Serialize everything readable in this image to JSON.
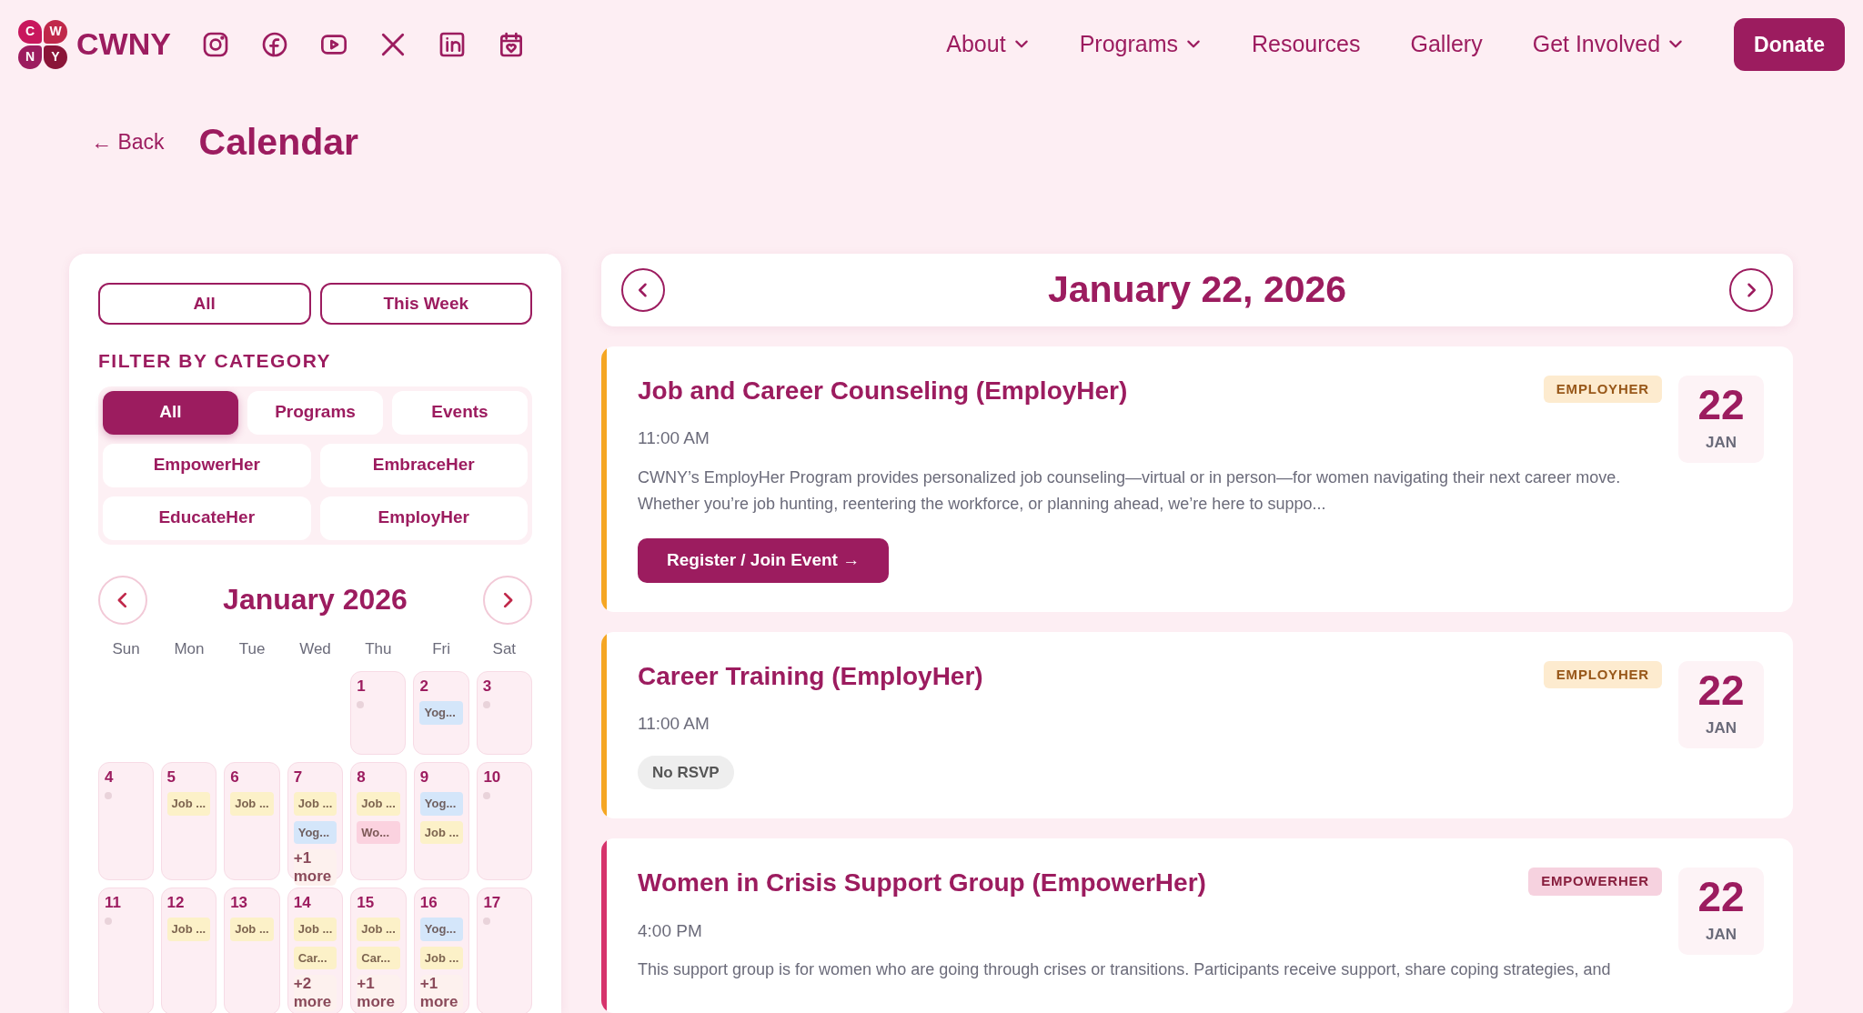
{
  "header": {
    "logo_letters": [
      "C",
      "W",
      "N",
      "Y"
    ],
    "brand": "CWNY",
    "nav": [
      {
        "label": "About",
        "dropdown": true
      },
      {
        "label": "Programs",
        "dropdown": true
      },
      {
        "label": "Resources",
        "dropdown": false
      },
      {
        "label": "Gallery",
        "dropdown": false
      },
      {
        "label": "Get Involved",
        "dropdown": true
      }
    ],
    "donate": "Donate"
  },
  "page": {
    "back": "← Back",
    "title": "Calendar"
  },
  "sidebar": {
    "range_tabs": [
      {
        "label": "All"
      },
      {
        "label": "This Week"
      }
    ],
    "filter_heading": "FILTER BY CATEGORY",
    "categories": [
      {
        "label": "All",
        "selected": true
      },
      {
        "label": "Programs",
        "selected": false
      },
      {
        "label": "Events",
        "selected": false
      },
      {
        "label": "EmpowerHer",
        "selected": false
      },
      {
        "label": "EmbraceHer",
        "selected": false
      },
      {
        "label": "EducateHer",
        "selected": false
      },
      {
        "label": "EmployHer",
        "selected": false
      }
    ],
    "month": "January 2026",
    "weekdays": [
      "Sun",
      "Mon",
      "Tue",
      "Wed",
      "Thu",
      "Fri",
      "Sat"
    ],
    "weeks": [
      {
        "days": [
          {
            "day": "1"
          },
          {
            "day": "2",
            "events": [
              {
                "label": "Yog...",
                "color": "#d4e6fa"
              }
            ]
          },
          {
            "day": "3"
          }
        ]
      },
      {
        "days": [
          {
            "day": "4"
          },
          {
            "day": "5",
            "events": [
              {
                "label": "Job ...",
                "color": "#fcf1c8"
              }
            ]
          },
          {
            "day": "6",
            "events": [
              {
                "label": "Job ...",
                "color": "#fcf1c8"
              }
            ]
          },
          {
            "day": "7",
            "events": [
              {
                "label": "Job ...",
                "color": "#fcf1c8"
              },
              {
                "label": "Yog...",
                "color": "#d4e6fa"
              }
            ],
            "more": "+1 more"
          },
          {
            "day": "8",
            "events": [
              {
                "label": "Job ...",
                "color": "#fcf1c8"
              },
              {
                "label": "Wo...",
                "color": "#fbd2df"
              }
            ]
          },
          {
            "day": "9",
            "events": [
              {
                "label": "Yog...",
                "color": "#d4e6fa"
              },
              {
                "label": "Job ...",
                "color": "#fcf1c8"
              }
            ]
          },
          {
            "day": "10"
          }
        ]
      },
      {
        "days": [
          {
            "day": "11"
          },
          {
            "day": "12",
            "events": [
              {
                "label": "Job ...",
                "color": "#fcf1c8"
              }
            ]
          },
          {
            "day": "13",
            "events": [
              {
                "label": "Job ...",
                "color": "#fcf1c8"
              }
            ]
          },
          {
            "day": "14",
            "events": [
              {
                "label": "Job ...",
                "color": "#fcf1c8"
              },
              {
                "label": "Car...",
                "color": "#fcf1c8"
              }
            ],
            "more": "+2 more"
          },
          {
            "day": "15",
            "events": [
              {
                "label": "Job ...",
                "color": "#fcf1c8"
              },
              {
                "label": "Car...",
                "color": "#fcf1c8"
              }
            ],
            "more": "+1 more"
          },
          {
            "day": "16",
            "events": [
              {
                "label": "Yog...",
                "color": "#d4e6fa"
              },
              {
                "label": "Job ...",
                "color": "#fcf1c8"
              }
            ],
            "more": "+1 more"
          },
          {
            "day": "17"
          }
        ]
      }
    ]
  },
  "day_view": {
    "date": "January 22, 2026",
    "events": [
      {
        "title": "Job and Career Counseling (EmployHer)",
        "color": "#f5a623",
        "badge": "EMPLOYHER",
        "time": "11:00 AM",
        "description": "CWNY’s EmployHer Program provides personalized job counseling—virtual or in person—for women navigating their next career move. Whether you’re job hunting, reentering the workforce, or planning ahead, we’re here to suppo...",
        "action": {
          "kind": "button",
          "label": "Register / Join Event →"
        },
        "day": "22",
        "month": "JAN"
      },
      {
        "title": "Career Training (EmployHer)",
        "color": "#f5a623",
        "badge": "EMPLOYHER",
        "time": "11:00 AM",
        "action": {
          "kind": "pill",
          "label": "No RSVP"
        },
        "day": "22",
        "month": "JAN"
      },
      {
        "title": "Women in Crisis Support Group (EmpowerHer)",
        "color": "#d6336c",
        "badge": "EMPOWERHER",
        "time": "4:00 PM",
        "description": "This support group is for women who are going through crises or transitions. Participants receive support, share coping strategies, and",
        "day": "22",
        "month": "JAN"
      }
    ]
  }
}
